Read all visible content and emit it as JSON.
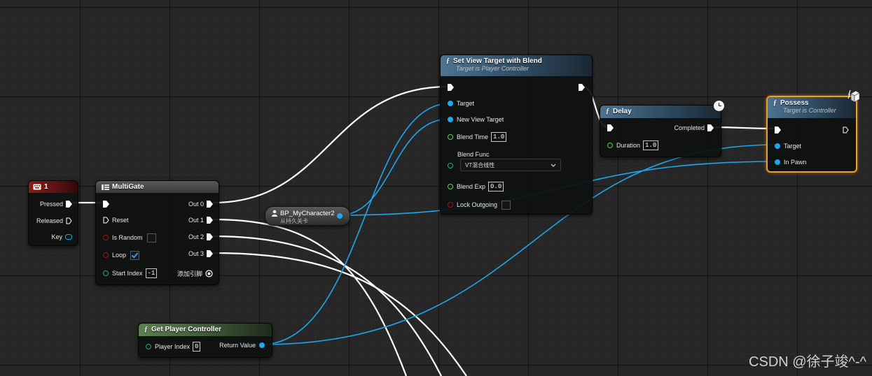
{
  "nodes": {
    "key_event": {
      "title": "1",
      "pins": {
        "pressed": "Pressed",
        "released": "Released",
        "key": "Key"
      }
    },
    "multigate": {
      "title": "MultiGate",
      "pins": {
        "reset": "Reset",
        "is_random": "Is Random",
        "loop": "Loop",
        "start_index": "Start Index",
        "start_index_value": "-1",
        "add_pin": "添加引脚",
        "out0": "Out 0",
        "out1": "Out 1",
        "out2": "Out 2",
        "out3": "Out 3"
      },
      "is_random_checked": false,
      "loop_checked": true
    },
    "bp_var": {
      "name": "BP_MyCharacter2",
      "subtitle": "从持久关卡"
    },
    "set_view_target": {
      "title": "Set View Target with Blend",
      "subtitle": "Target is Player Controller",
      "pins": {
        "target": "Target",
        "new_view_target": "New View Target",
        "blend_time": "Blend Time",
        "blend_time_value": "1.0",
        "blend_func": "Blend Func",
        "blend_func_value": "VT混合线性",
        "blend_exp": "Blend Exp",
        "blend_exp_value": "0.0",
        "lock_outgoing": "Lock Outgoing"
      }
    },
    "delay": {
      "title": "Delay",
      "pins": {
        "duration": "Duration",
        "duration_value": "1.0",
        "completed": "Completed"
      }
    },
    "possess": {
      "title": "Possess",
      "subtitle": "Target is Controller",
      "pins": {
        "target": "Target",
        "in_pawn": "In Pawn"
      }
    },
    "get_player_controller": {
      "title": "Get Player Controller",
      "pins": {
        "player_index": "Player Index",
        "player_index_value": "0",
        "return_value": "Return Value"
      }
    }
  },
  "icons": {
    "function": "ƒ",
    "keyboard": "keyboard-icon",
    "multigate": "multigate-icon",
    "clock": "clock-icon",
    "network": "network-icon",
    "person": "person-icon"
  },
  "colors": {
    "exec": "#ffffff",
    "object_pin": "#1fa6ec",
    "float_pin": "#54d64f",
    "bool_pin": "#a31212",
    "int_pin": "#1eaa8e",
    "possess_border": "#f0a020"
  },
  "watermark": "CSDN @徐子竣^-^"
}
